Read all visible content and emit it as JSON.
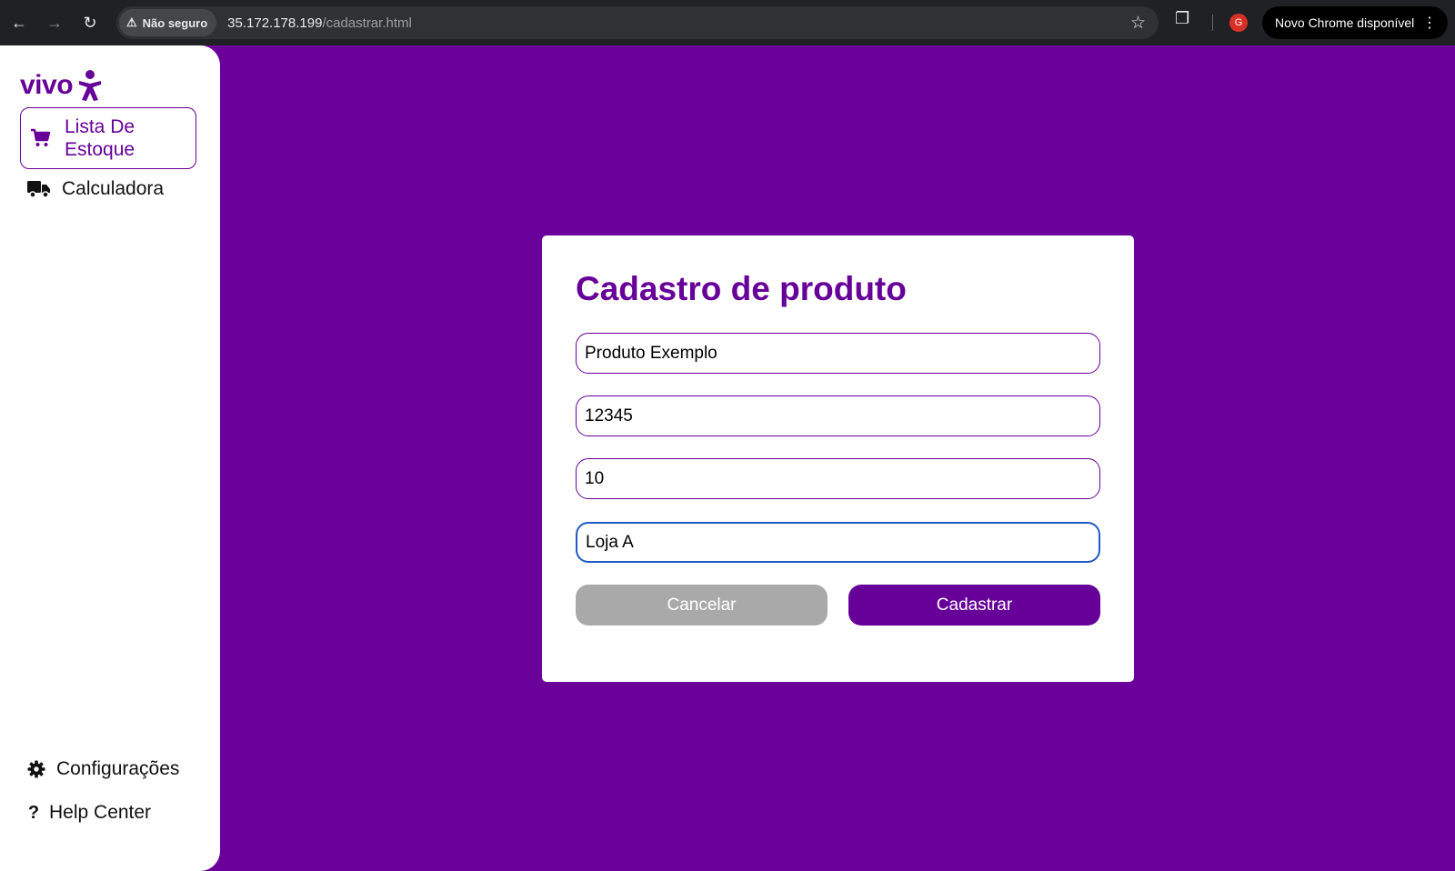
{
  "browser": {
    "security_label": "Não seguro",
    "url_host": "35.172.178.199",
    "url_path": "/cadastrar.html",
    "profile_initial": "G",
    "update_label": "Novo Chrome disponível"
  },
  "sidebar": {
    "logo_text": "vivo",
    "items": [
      {
        "label": "Lista De Estoque",
        "icon": "cart-icon",
        "active": true
      },
      {
        "label": "Calculadora",
        "icon": "truck-icon",
        "active": false
      }
    ],
    "bottom_items": [
      {
        "label": "Configurações",
        "icon": "gear-icon"
      },
      {
        "label": "Help Center",
        "icon": "question-icon"
      }
    ]
  },
  "form": {
    "title": "Cadastro de produto",
    "fields": [
      {
        "value": "Produto Exemplo"
      },
      {
        "value": "12345"
      },
      {
        "value": "10"
      },
      {
        "value": "Loja A",
        "focused": true
      }
    ],
    "cancel_label": "Cancelar",
    "submit_label": "Cadastrar"
  },
  "colors": {
    "brand_purple": "#660099",
    "background": "#6a0099",
    "cancel_gray": "#a9a9a9",
    "focus_blue": "#1f5bc6"
  }
}
